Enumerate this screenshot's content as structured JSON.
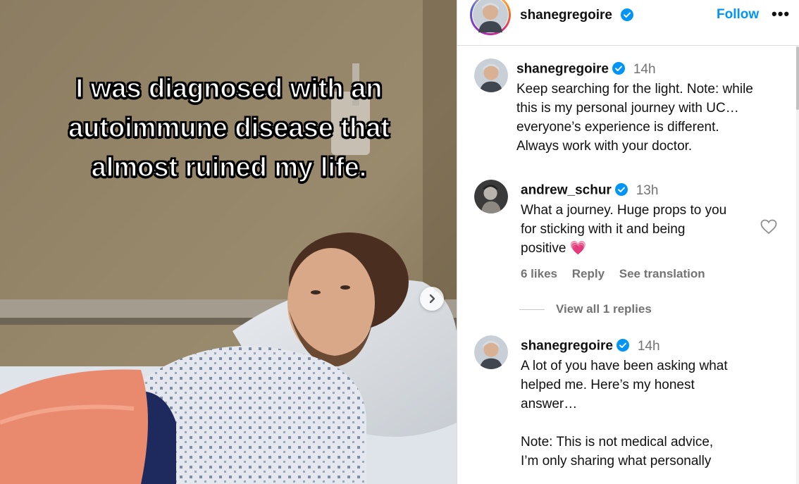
{
  "post": {
    "overlay_text": "I was diagnosed with an\nautoimmune disease that\nalmost ruined my life.",
    "next_icon": "chevron-right-icon"
  },
  "header": {
    "username": "shanegregoire",
    "verified_icon": "verified-badge-icon",
    "follow_label": "Follow",
    "more_label": "•••"
  },
  "comments": [
    {
      "username": "shanegregoire",
      "time": "14h",
      "text": "Keep searching for the light. Note: while\nthis is my personal journey with UC…\neveryone’s experience is different.\nAlways work with your doctor."
    },
    {
      "username": "andrew_schur",
      "time": "13h",
      "text": "What a journey. Huge props to you\nfor sticking with it and being\npositive ",
      "emoji": "💗",
      "likes": "6 likes",
      "reply_label": "Reply",
      "translate_label": "See translation",
      "view_replies": "View all 1 replies"
    },
    {
      "username": "shanegregoire",
      "time": "14h",
      "text": "A lot of you have been asking what\nhelped me. Here’s my honest\nanswer…\n\nNote: This is not medical advice,\nI’m only sharing what personally"
    }
  ],
  "colors": {
    "accent": "#0095f6",
    "verified": "#0095f6",
    "secondary_text": "#737373",
    "divider": "#dbdbdb"
  }
}
